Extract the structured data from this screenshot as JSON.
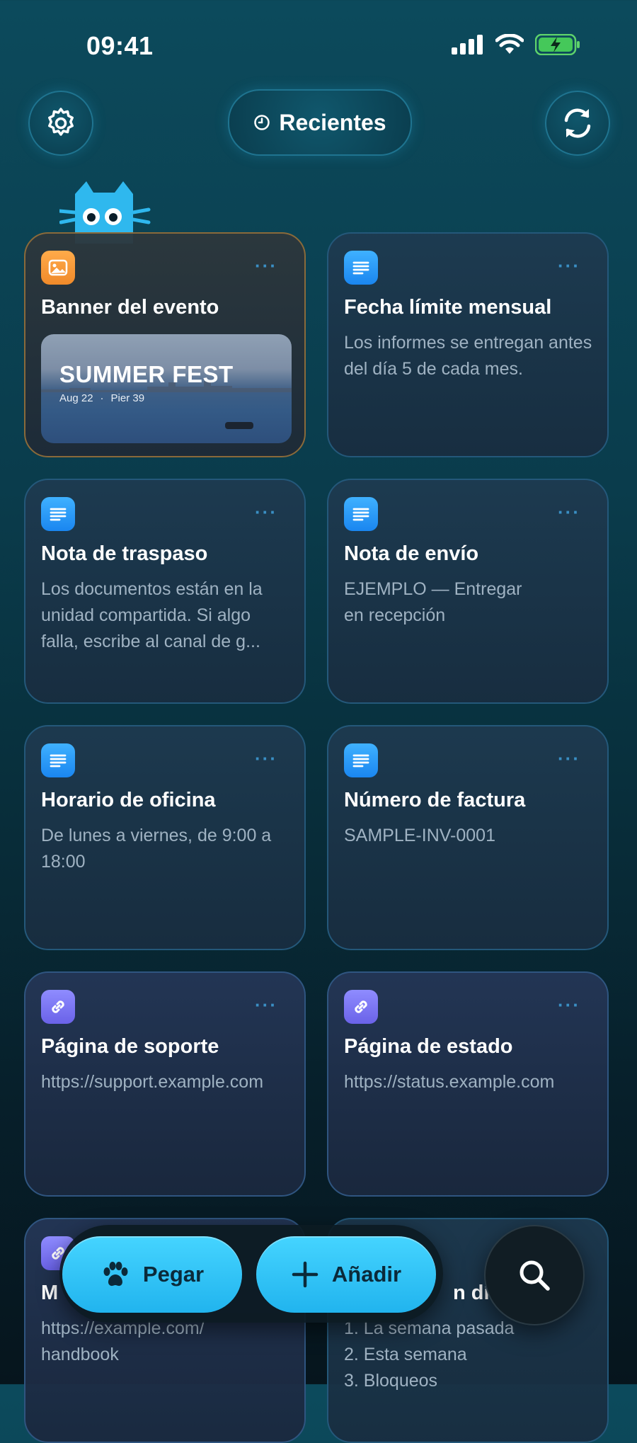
{
  "status_bar": {
    "time": "09:41"
  },
  "header": {
    "filter_label": "Recientes"
  },
  "cards": [
    {
      "type": "image",
      "title": "Banner del evento",
      "banner": {
        "title": "SUMMER FEST",
        "date": "Aug 22",
        "separator": "·",
        "place": "Pier 39"
      }
    },
    {
      "type": "text",
      "title": "Fecha límite mensual",
      "body": "Los informes se entregan antes del día 5 de cada mes."
    },
    {
      "type": "text",
      "title": "Nota de traspaso",
      "body": "Los documentos están en la unidad compartida. Si algo falla, escribe al canal de g..."
    },
    {
      "type": "text",
      "title": "Nota de envío",
      "body": "EJEMPLO — Entregar\nen recepción"
    },
    {
      "type": "text",
      "title": "Horario de oficina",
      "body": "De lunes a viernes, de 9:00 a 18:00"
    },
    {
      "type": "text",
      "title": "Número de factura",
      "body": "SAMPLE-INV-0001"
    },
    {
      "type": "link",
      "title": "Página de soporte",
      "body": "https://support.example.com"
    },
    {
      "type": "link",
      "title": "Página de estado",
      "body": "https://status.example.com"
    },
    {
      "type": "link",
      "title": "M",
      "body": "https://example.com/\nhandbook"
    },
    {
      "type": "text",
      "title": "n día",
      "body": "1. La semana pasada\n2. Esta semana\n3. Bloqueos"
    }
  ],
  "more_label": "···",
  "bottom": {
    "paste_label": "Pegar",
    "add_label": "Añadir"
  },
  "colors": {
    "accent": "#2bbcf2",
    "text_icon": "#3fb1ff",
    "image_icon": "#ffab4a",
    "link_icon": "#8f8cff"
  }
}
